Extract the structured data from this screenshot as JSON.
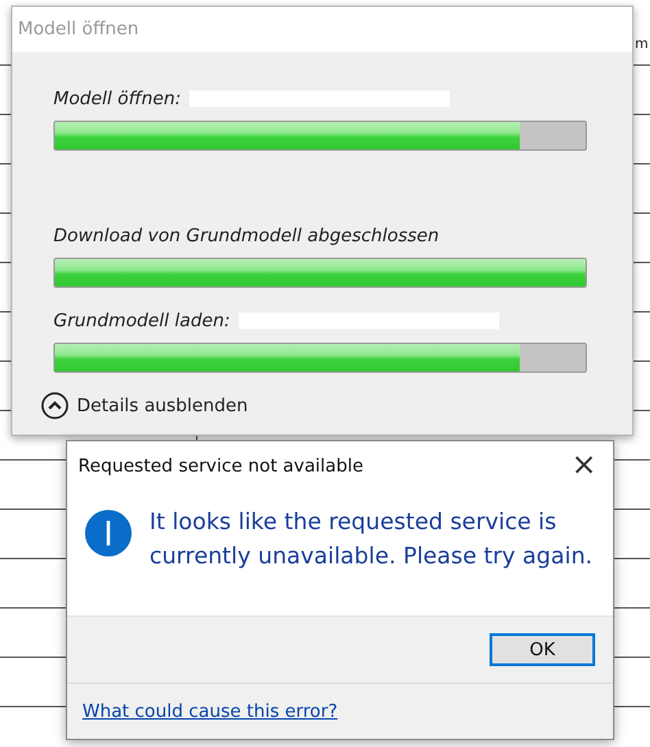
{
  "background": {
    "row_count_text": "m"
  },
  "progress_dialog": {
    "title": "Modell öffnen",
    "steps": [
      {
        "label": "Modell öffnen:",
        "redacted": true,
        "level": 0.875
      },
      {
        "label": "Download von Grundmodell abgeschlossen",
        "redacted": false,
        "level": 1.0
      },
      {
        "label": "Grundmodell laden:",
        "redacted": true,
        "level": 0.875
      }
    ],
    "details_toggle": {
      "label": "Details ausblenden",
      "expanded": true
    }
  },
  "error_dialog": {
    "title": "Requested service not available",
    "close": "×",
    "message": "It looks like the requested service is currently unavailable. Please try again.",
    "buttons": [
      "OK"
    ],
    "link": "What could cause this error?"
  }
}
